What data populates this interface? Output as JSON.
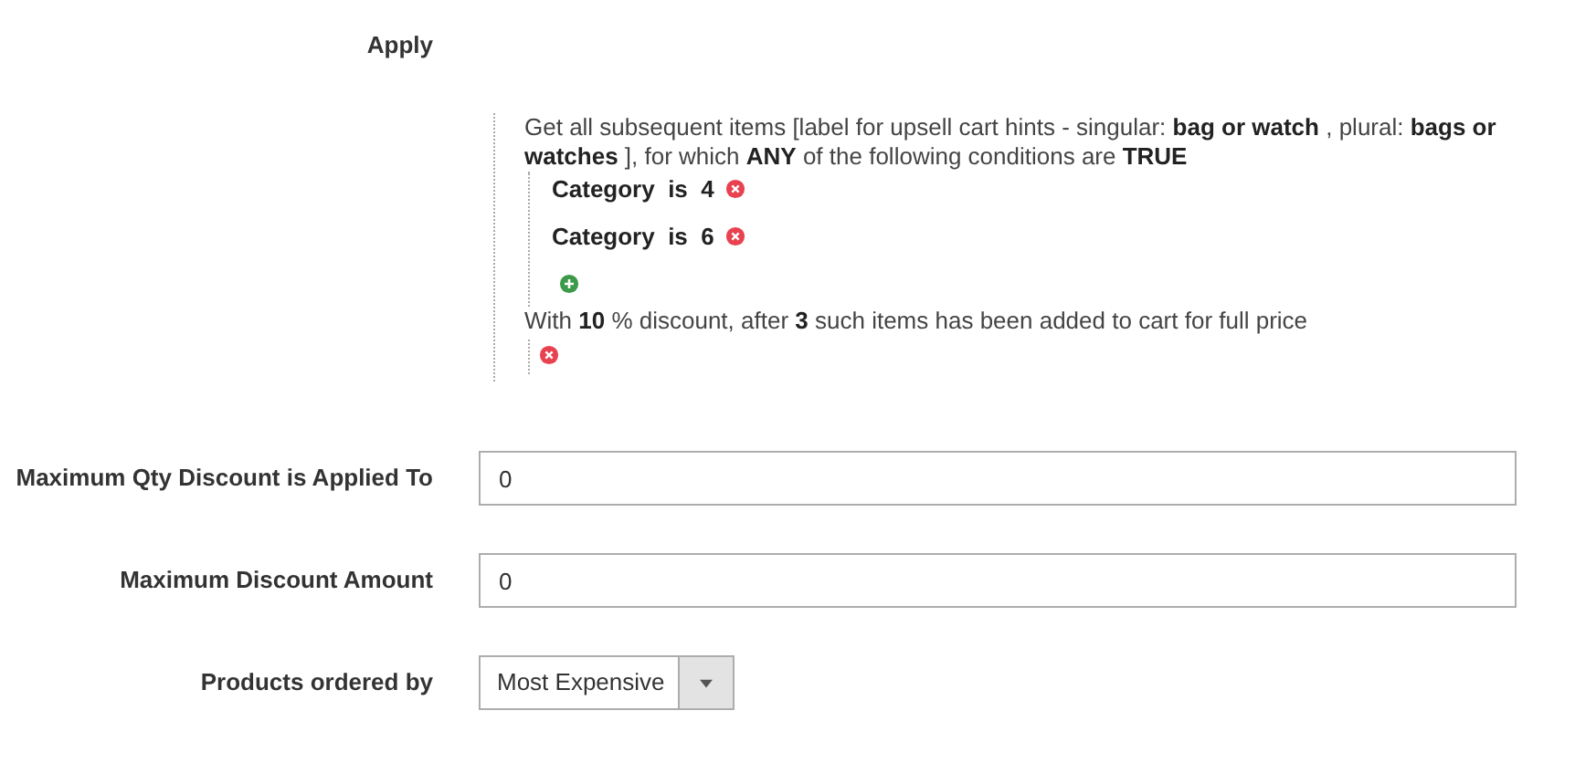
{
  "apply": {
    "label": "Apply",
    "rule": {
      "intro": "Get all subsequent items [label for upsell cart hints - singular: **bag or watch** , plural: **bags or watches** ], for which **ANY**  of the following conditions are **TRUE**",
      "conditions": [
        {
          "text": "Category  is  4"
        },
        {
          "text": "Category  is  6"
        }
      ],
      "action": "With **10** % discount, after **3**  such items has been added to cart for full price"
    }
  },
  "fields": [
    {
      "kind": "input",
      "label": "Maximum Qty Discount is Applied To",
      "value": "0"
    },
    {
      "kind": "input",
      "label": "Maximum Discount Amount",
      "value": "0"
    },
    {
      "kind": "select",
      "label": "Products ordered by",
      "value": "Most Expensive"
    }
  ]
}
